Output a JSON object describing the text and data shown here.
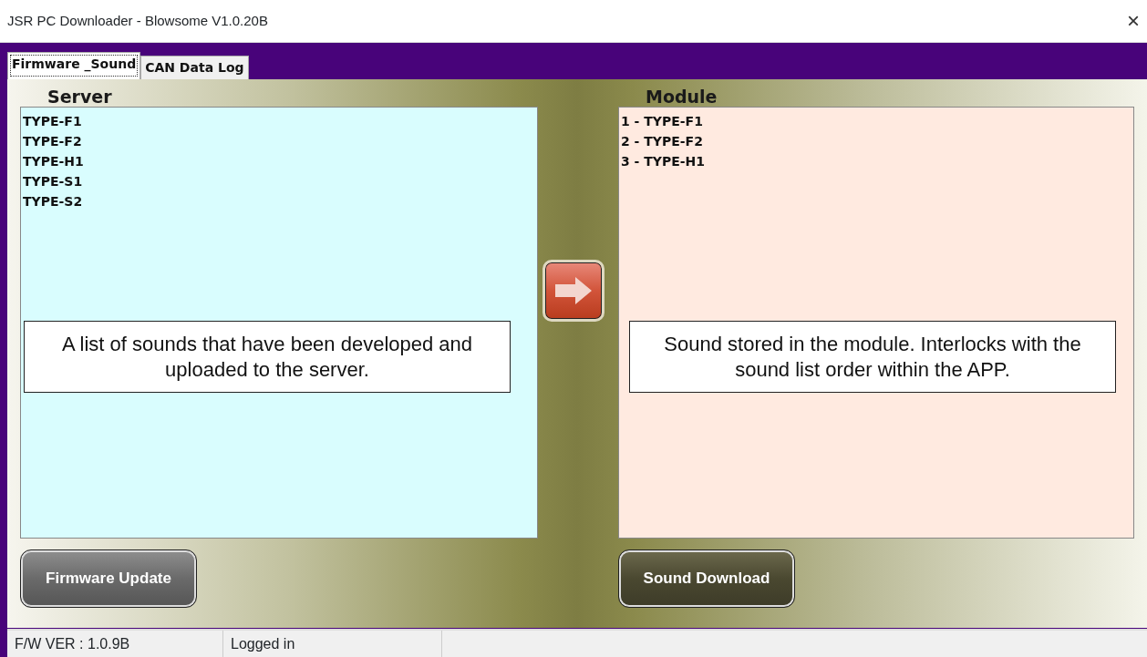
{
  "window": {
    "title": "JSR PC Downloader - Blowsome V1.0.20B",
    "close": "×"
  },
  "tabs": [
    {
      "label": "Firmware _Sound",
      "selected": true
    },
    {
      "label": "CAN Data Log",
      "selected": false
    }
  ],
  "server": {
    "label": "Server",
    "items": [
      "TYPE-F1",
      "TYPE-F2",
      "TYPE-H1",
      "TYPE-S1",
      "TYPE-S2"
    ],
    "callout": "A list of sounds that have been developed and uploaded to the server."
  },
  "module": {
    "label": "Module",
    "items": [
      "1 - TYPE-F1",
      "2 - TYPE-F2",
      "3 - TYPE-H1"
    ],
    "callout": "Sound stored in the module. Interlocks with the sound list order within the APP."
  },
  "buttons": {
    "firmware_update": "Firmware Update",
    "sound_download": "Sound Download"
  },
  "status_bar": [
    "F/W VER : 1.0.9B",
    "Logged in"
  ]
}
